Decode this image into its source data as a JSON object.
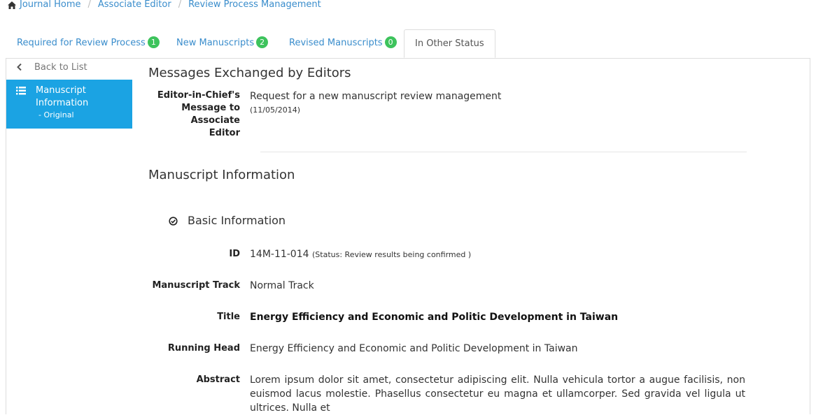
{
  "breadcrumb": {
    "items": [
      "Journal Home",
      "Associate Editor",
      "Review Process Management"
    ]
  },
  "tabs": [
    {
      "label": "Required for Review Process",
      "count": "1"
    },
    {
      "label": "New Manuscripts",
      "count": "2"
    },
    {
      "label": "Revised Manuscripts",
      "count": "0"
    },
    {
      "label": "In Other Status"
    }
  ],
  "sidebar": {
    "back_label": "Back to List",
    "active_line1": "Manuscript",
    "active_line2": "Information",
    "active_sub": "- Original"
  },
  "messages": {
    "heading": "Messages Exchanged by Editors",
    "label_line1": "Editor-in-Chief's",
    "label_line2": "Message to Associate",
    "label_line3": "Editor",
    "text": "Request for a new manuscript review management",
    "date": "(11/05/2014)"
  },
  "manuscript": {
    "heading": "Manuscript Information",
    "basic_heading": "Basic Information",
    "id_label": "ID",
    "id_value": "14M-11-014",
    "id_status": "(Status: Review results being confirmed )",
    "track_label": "Manuscript Track",
    "track_value": "Normal Track",
    "title_label": "Title",
    "title_value": "Energy Efficiency and Economic and Politic Development in Taiwan",
    "running_head_label": "Running Head",
    "running_head_value": "Energy Efficiency and Economic and Politic Development in Taiwan",
    "abstract_label": "Abstract",
    "abstract_value": "Lorem ipsum dolor sit amet, consectetur adipiscing elit. Nulla vehicula tortor a augue facilisis, non euismod lacus molestie. Phasellus consectetur eu magna et ullamcorper. Sed gravida vel ligula ut ultrices. Nulla et"
  },
  "colors": {
    "link": "#3a8dcc",
    "badge": "#3dc35c",
    "active_nav": "#1ba3e3"
  },
  "icons": [
    "home-icon",
    "chevron-left-icon",
    "list-icon",
    "check-circle-icon"
  ]
}
